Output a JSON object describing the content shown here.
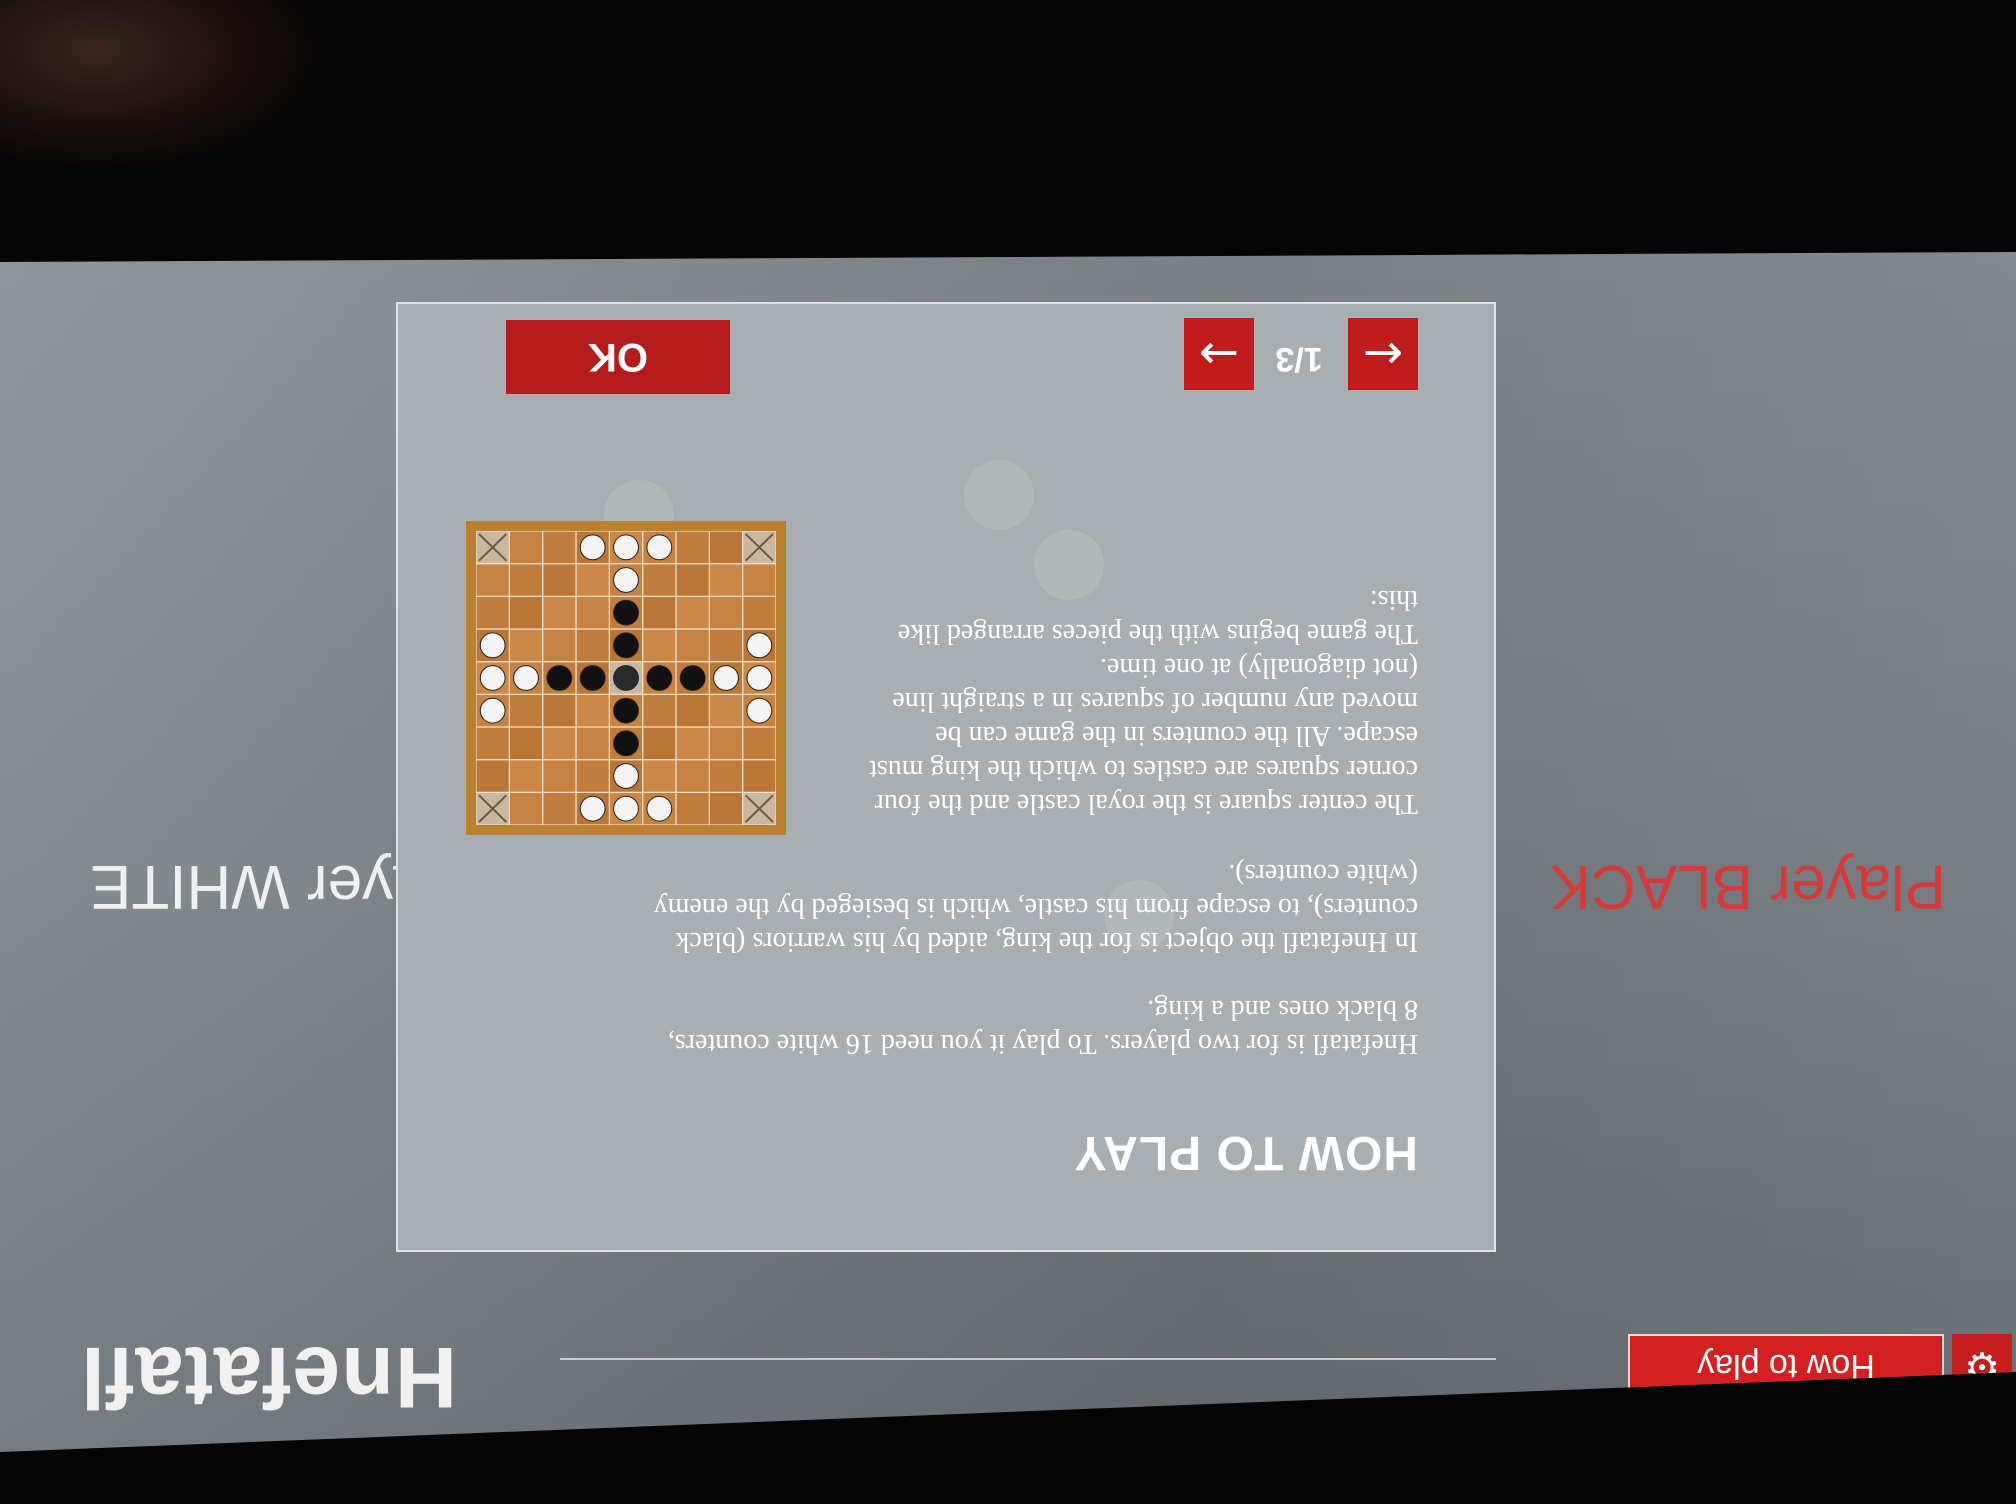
{
  "app": {
    "title": "Hnefatafl"
  },
  "header": {
    "howto_label": "How to play",
    "gear_icon": "gear-icon"
  },
  "players": {
    "black_label": "Player BLACK",
    "white_label": "Player WHITE"
  },
  "dialog": {
    "title": "HOW TO PLAY",
    "paragraphs": [
      "Hnefatafl is for two players. To play it you need 16 white counters, 8 black ones and a king.",
      "In Hnefatafl the object is for the king, aided by his warriors (black counters), to escape from his castle, which is besieged by the enemy (white counters).",
      "The center square is the royal castle and the four corner squares are castles to which the king must escape. All the counters in the game can be moved any number of squares in a straight line (not diagonally) at one time.",
      "The game begins with the pieces arranged like this:"
    ],
    "page_indicator": "1/3",
    "prev_icon": "arrow-left-icon",
    "next_icon": "arrow-right-icon",
    "ok_label": "OK"
  },
  "colors": {
    "accent_red": "#c81d1d",
    "player_black_text": "#d83a3a",
    "screen_gray": "#8a9196",
    "dialog_gray": "#a8aeb1"
  },
  "board": {
    "size": 9,
    "white": [
      [
        0,
        3
      ],
      [
        0,
        4
      ],
      [
        0,
        5
      ],
      [
        1,
        4
      ],
      [
        3,
        0
      ],
      [
        4,
        0
      ],
      [
        5,
        0
      ],
      [
        4,
        1
      ],
      [
        3,
        8
      ],
      [
        4,
        8
      ],
      [
        5,
        8
      ],
      [
        4,
        7
      ],
      [
        8,
        3
      ],
      [
        8,
        4
      ],
      [
        8,
        5
      ],
      [
        7,
        4
      ]
    ],
    "black": [
      [
        2,
        4
      ],
      [
        3,
        4
      ],
      [
        5,
        4
      ],
      [
        6,
        4
      ],
      [
        4,
        2
      ],
      [
        4,
        3
      ],
      [
        4,
        5
      ],
      [
        4,
        6
      ]
    ],
    "king": [
      4,
      4
    ]
  }
}
